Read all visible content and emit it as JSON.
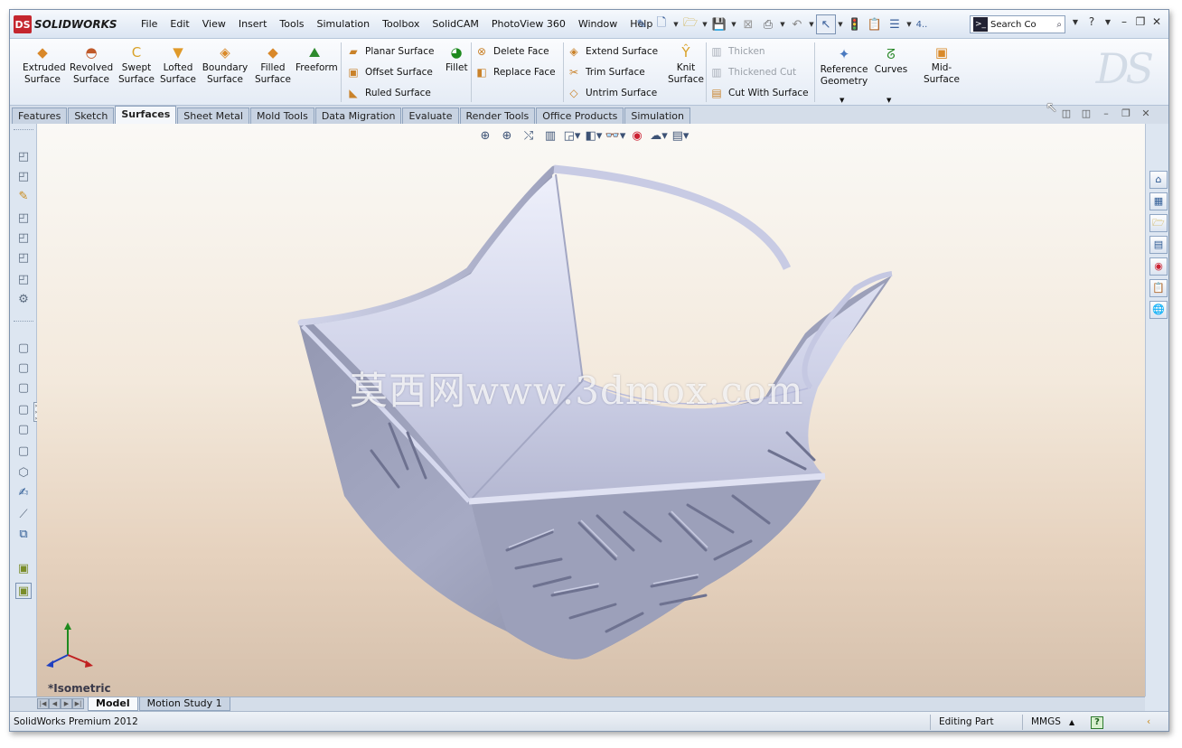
{
  "app": {
    "name": "SOLIDWORKS",
    "logo_mark": "DS"
  },
  "menu": [
    "File",
    "Edit",
    "View",
    "Insert",
    "Tools",
    "Simulation",
    "Toolbox",
    "SolidCAM",
    "PhotoView 360",
    "Window",
    "Help"
  ],
  "quick_tools_overflow": "4..",
  "search": {
    "placeholder": "Search Co"
  },
  "help_glyph": "?",
  "commands_big": [
    {
      "label": "Extruded\nSurface",
      "icon": "extruded-surface-icon",
      "glyph": "◆"
    },
    {
      "label": "Revolved\nSurface",
      "icon": "revolved-surface-icon",
      "glyph": "◓"
    },
    {
      "label": "Swept\nSurface",
      "icon": "swept-surface-icon",
      "glyph": "C"
    },
    {
      "label": "Lofted\nSurface",
      "icon": "lofted-surface-icon",
      "glyph": "▼"
    },
    {
      "label": "Boundary\nSurface",
      "icon": "boundary-surface-icon",
      "glyph": "◈"
    },
    {
      "label": "Filled\nSurface",
      "icon": "filled-surface-icon",
      "glyph": "◆"
    },
    {
      "label": "Freeform",
      "icon": "freeform-icon",
      "glyph": "⛰"
    },
    {
      "label": "Fillet",
      "icon": "fillet-icon",
      "glyph": "◕"
    },
    {
      "label": "Knit\nSurface",
      "icon": "knit-surface-icon",
      "glyph": "Ŷ"
    },
    {
      "label": "Reference\nGeometry",
      "icon": "reference-geometry-icon",
      "glyph": "✦"
    },
    {
      "label": "Curves",
      "icon": "curves-icon",
      "glyph": "ᘔ"
    },
    {
      "label": "Mid-Surface",
      "icon": "mid-surface-icon",
      "glyph": "▣"
    }
  ],
  "commands_small": [
    {
      "label": "Planar Surface",
      "icon": "planar-surface-icon",
      "glyph": "▰",
      "enabled": true
    },
    {
      "label": "Offset Surface",
      "icon": "offset-surface-icon",
      "glyph": "▣",
      "enabled": true
    },
    {
      "label": "Ruled Surface",
      "icon": "ruled-surface-icon",
      "glyph": "◣",
      "enabled": true
    },
    {
      "label": "Delete Face",
      "icon": "delete-face-icon",
      "glyph": "⊗",
      "enabled": true
    },
    {
      "label": "Replace Face",
      "icon": "replace-face-icon",
      "glyph": "◧",
      "enabled": true
    },
    {
      "label": "Extend Surface",
      "icon": "extend-surface-icon",
      "glyph": "◈",
      "enabled": true
    },
    {
      "label": "Trim Surface",
      "icon": "trim-surface-icon",
      "glyph": "✂",
      "enabled": true
    },
    {
      "label": "Untrim Surface",
      "icon": "untrim-surface-icon",
      "glyph": "◇",
      "enabled": true
    },
    {
      "label": "Thicken",
      "icon": "thicken-icon",
      "glyph": "▥",
      "enabled": false
    },
    {
      "label": "Thickened Cut",
      "icon": "thickened-cut-icon",
      "glyph": "▥",
      "enabled": false
    },
    {
      "label": "Cut With Surface",
      "icon": "cut-with-surface-icon",
      "glyph": "▤",
      "enabled": true
    }
  ],
  "tabs": [
    "Features",
    "Sketch",
    "Surfaces",
    "Sheet Metal",
    "Mold Tools",
    "Data Migration",
    "Evaluate",
    "Render Tools",
    "Office Products",
    "Simulation"
  ],
  "active_tab": "Surfaces",
  "watermark": "莫西网www.3dmox.com",
  "view": {
    "orientation": "*Isometric"
  },
  "bottom_tabs": [
    "Model",
    "Motion Study 1"
  ],
  "active_bottom_tab": "Model",
  "status": {
    "product": "SolidWorks Premium 2012",
    "mode": "Editing Part",
    "units": "MMGS",
    "units_arrow": "▲",
    "help": "?"
  },
  "colors": {
    "accent": "#2d5a94",
    "logo_red": "#c4262e",
    "model": "#b9bdd4"
  }
}
